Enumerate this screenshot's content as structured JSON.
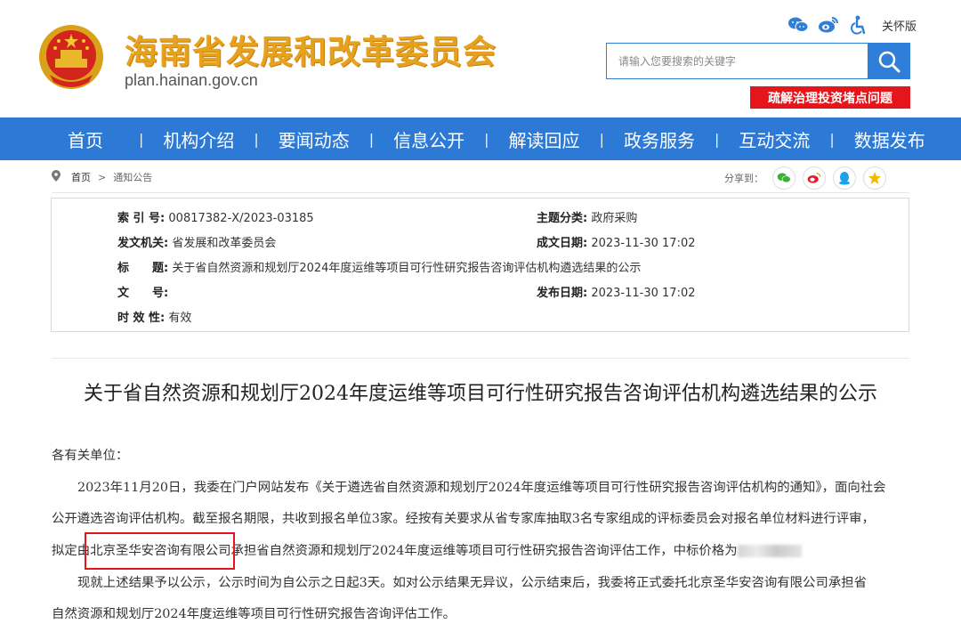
{
  "site": {
    "title": "海南省发展和改革委员会",
    "url": "plan.hainan.gov.cn",
    "care_mode": "关怀版",
    "search_placeholder": "请输入您要搜索的关键字",
    "banner": "疏解治理投资堵点问题"
  },
  "nav": [
    "首页",
    "机构介绍",
    "要闻动态",
    "信息公开",
    "解读回应",
    "政务服务",
    "互动交流",
    "数据发布"
  ],
  "breadcrumb": {
    "home": "首页",
    "arrow": ">",
    "current": "通知公告",
    "share_label": "分享到："
  },
  "info": {
    "index_label": "索 引 号:",
    "index_value": "00817382-X/2023-03185",
    "topic_label": "主题分类:",
    "topic_value": "政府采购",
    "issuer_label": "发文机关:",
    "issuer_value": "省发展和改革委员会",
    "created_label": "成文日期:",
    "created_value": "2023-11-30 17:02",
    "subject_label": "标　　题:",
    "subject_value": "关于省自然资源和规划厅2024年度运维等项目可行性研究报告咨询评估机构遴选结果的公示",
    "docno_label": "文　　号:",
    "docno_value": "",
    "published_label": "发布日期:",
    "published_value": "2023-11-30 17:02",
    "validity_label": "时 效 性:",
    "validity_value": "有效"
  },
  "doc": {
    "title": "关于省自然资源和规划厅2024年度运维等项目可行性研究报告咨询评估机构遴选结果的公示",
    "salutation": "各有关单位：",
    "p1_line1": "2023年11月20日，我委在门户网站发布《关于遴选省自然资源和规划厅2024年度运维等项目可行性研究报告咨询评估机构的通知》，面向社会",
    "p1_line2": "公开遴选咨询评估机构。截至报名期限，共收到报名单位3家。经按有关要求从省专家库抽取3名专家组成的评标委员会对报名单位材料进行评审，",
    "p1_line3_a": "拟定由",
    "p1_line3_company": "北京圣华安咨询有限公司",
    "p1_line3_b": "承担省自然资源和规划厅2024年度运维等项目可行性研究报告咨询评估工作，中标价格为",
    "p2_line1": "现就上述结果予以公示，公示时间为自公示之日起3天。如对公示结果无异议，公示结束后，我委将正式委托北京圣华安咨询有限公司承担省",
    "p2_line2": "自然资源和规划厅2024年度运维等项目可行性研究报告咨询评估工作。"
  },
  "colors": {
    "nav_blue": "#2d7ad6",
    "title_gold": "#e6a21c",
    "banner_red": "#e5161b"
  }
}
